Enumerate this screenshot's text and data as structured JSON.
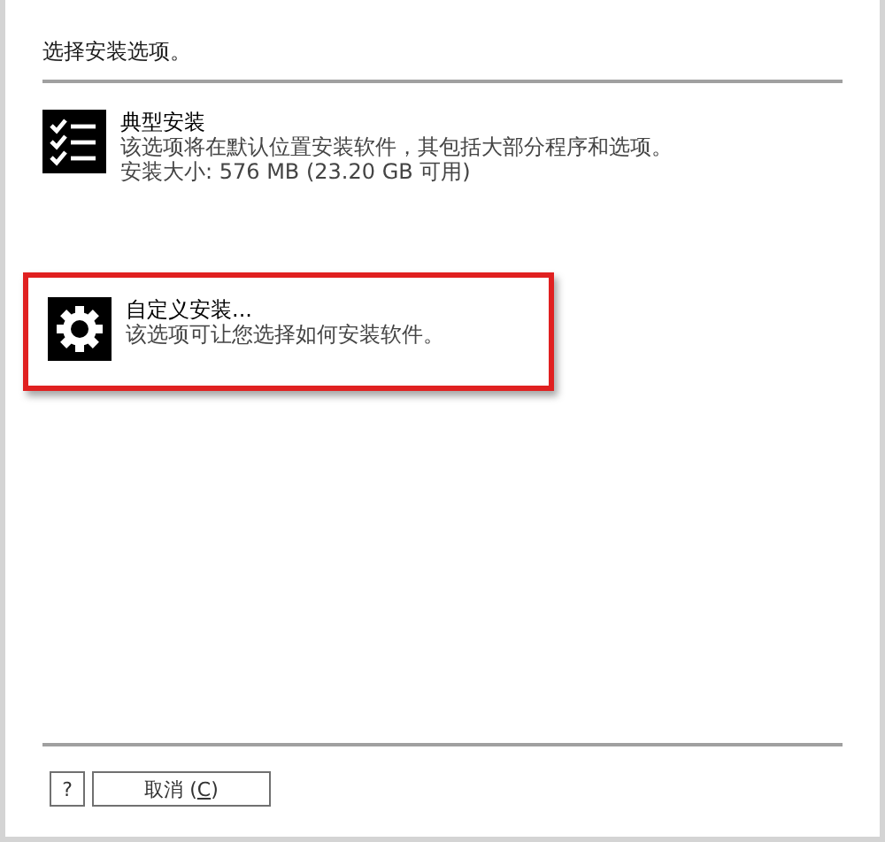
{
  "heading": "选择安装选项。",
  "options": [
    {
      "kind": "typical",
      "title": "典型安装",
      "description": "该选项将在默认位置安装软件，其包括大部分程序和选项。",
      "detail": "安装大小: 576 MB (23.20 GB 可用)",
      "highlighted": false
    },
    {
      "kind": "custom",
      "title": "自定义安装...",
      "description": "该选项可让您选择如何安装软件。",
      "highlighted": true
    }
  ],
  "buttons": [
    {
      "kind": "help",
      "label": "?"
    },
    {
      "kind": "cancel",
      "label_before": "取消 (",
      "access_key": "C",
      "label_after": ")"
    }
  ]
}
